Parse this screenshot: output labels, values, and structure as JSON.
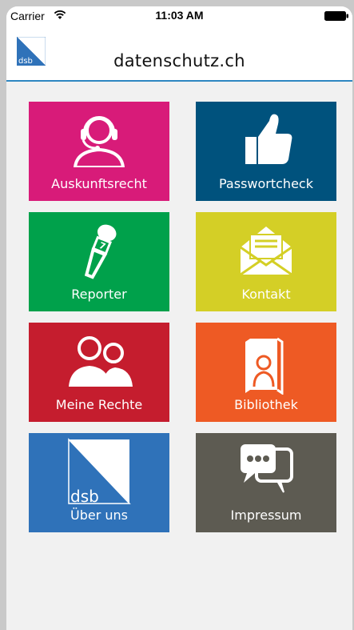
{
  "status_bar": {
    "carrier": "Carrier",
    "time": "11:03 AM"
  },
  "navbar": {
    "title": "datenschutz.ch",
    "logo_text": "dsb"
  },
  "tiles": [
    {
      "label": "Auskunftsrecht",
      "icon": "headset-person-icon",
      "color": "#d81b79"
    },
    {
      "label": "Passwortcheck",
      "icon": "thumbs-up-icon",
      "color": "#00527d"
    },
    {
      "label": "Reporter",
      "icon": "microphone-icon",
      "color": "#00a14b"
    },
    {
      "label": "Kontakt",
      "icon": "envelope-icon",
      "color": "#d4cf26"
    },
    {
      "label": "Meine Rechte",
      "icon": "two-people-icon",
      "color": "#c51d2e"
    },
    {
      "label": "Bibliothek",
      "icon": "book-icon",
      "color": "#ee5a24"
    },
    {
      "label": "Über uns",
      "icon": "dsb-logo-icon",
      "logo_text": "dsb",
      "color": "#2f72b9"
    },
    {
      "label": "Impressum",
      "icon": "chat-bubbles-icon",
      "color": "#5d5b52"
    }
  ]
}
